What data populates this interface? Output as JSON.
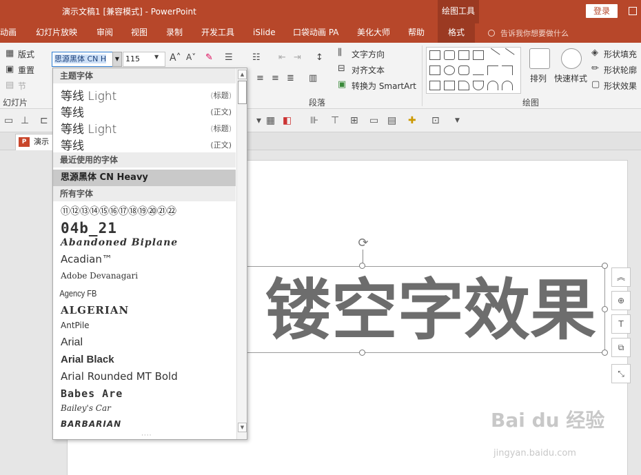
{
  "titlebar": {
    "title": "演示文稿1 [兼容模式] - PowerPoint",
    "context_tool": "绘图工具",
    "login": "登录"
  },
  "tabs": [
    "动画",
    "幻灯片放映",
    "审阅",
    "视图",
    "录制",
    "开发工具",
    "iSlide",
    "口袋动画 PA",
    "美化大师",
    "帮助",
    "格式"
  ],
  "active_tab": "格式",
  "tellme": "告诉我你想要做什么",
  "ribbon": {
    "layout": "版式",
    "reset": "重置",
    "section": "节",
    "slides_group": "幻灯片",
    "font_name": "思源黑体 CN H",
    "font_size": "115",
    "text_direction": "文字方向",
    "align_text": "对齐文本",
    "convert_smartart": "转换为 SmartArt",
    "paragraph_group": "段落",
    "arrange": "排列",
    "quick_styles": "快速样式",
    "shape_fill": "形状填充",
    "shape_outline": "形状轮廓",
    "shape_effects": "形状效果",
    "drawing_group": "绘图"
  },
  "doc_tab": {
    "badge": "P",
    "label": "演示"
  },
  "slide": {
    "text": "镂空字效果"
  },
  "dropdown": {
    "theme_fonts_header": "主题字体",
    "theme_fonts": [
      {
        "name": "等线 Light",
        "tag": "(标题)"
      },
      {
        "name": "等线",
        "tag": "(正文)"
      },
      {
        "name": "等线 Light",
        "tag": "(标题)"
      },
      {
        "name": "等线",
        "tag": "(正文)"
      }
    ],
    "recent_header": "最近使用的字体",
    "recent_font": "思源黑体 CN Heavy",
    "all_header": "所有字体",
    "all_fonts": [
      "⑪⑫⑬⑭⑮⑯⑰⑱⑲⑳㉑㉒",
      "04b_21",
      "Abandoned Biplane",
      "Acadian™",
      "Adobe Devanagari",
      "Agency FB",
      "ALGERIAN",
      "AntPile",
      "Arial",
      "Arial Black",
      "Arial Rounded MT Bold",
      "Babes Are",
      "Bailey's Car",
      "BARBARIAN"
    ]
  },
  "watermark": {
    "brand": "Bai du 经验",
    "url": "jingyan.baidu.com"
  }
}
